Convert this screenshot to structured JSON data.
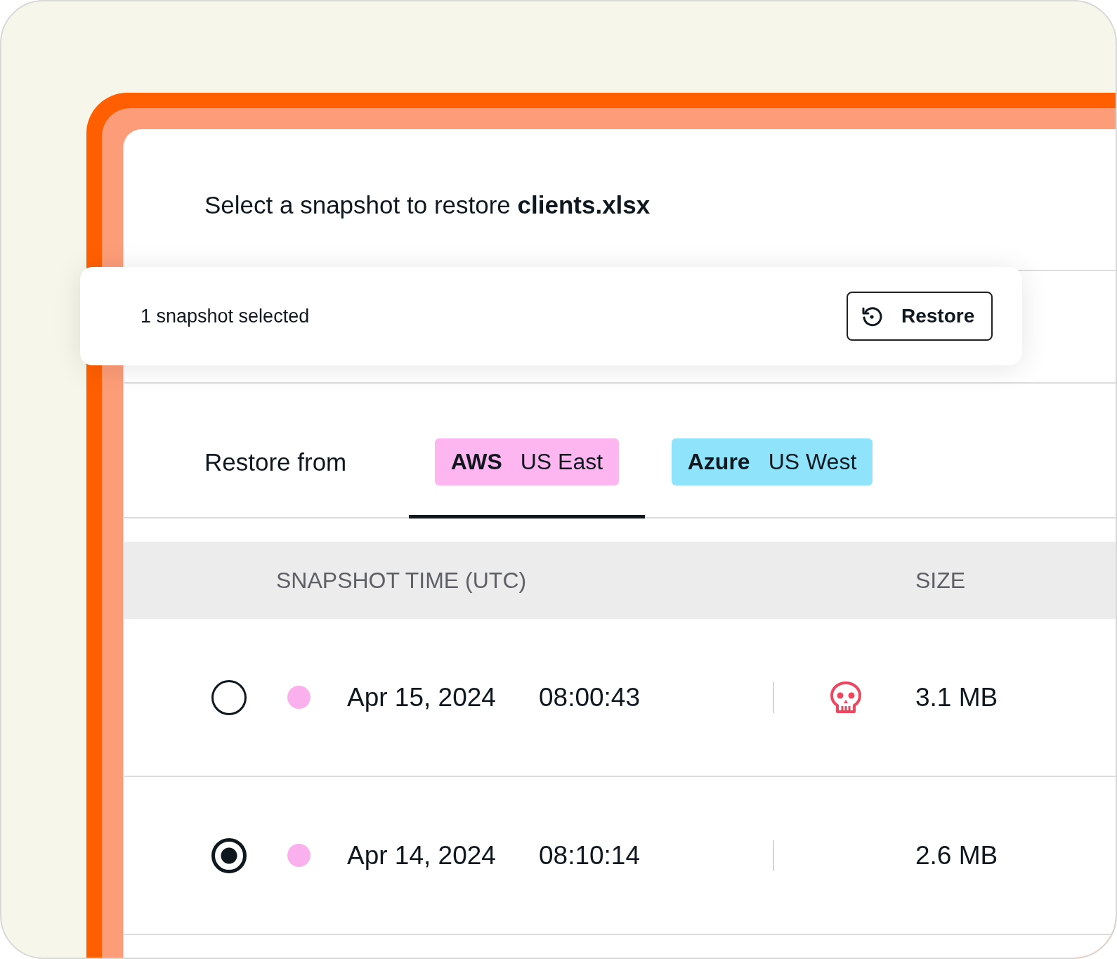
{
  "title": "Select a snapshot to restore **clients.xlsx**",
  "selection_bar": {
    "text": "1 snapshot selected",
    "button": "Restore"
  },
  "restore_from": {
    "label": "Restore from",
    "tabs": [
      {
        "provider": "AWS",
        "region": "US East",
        "color": "#fdb6f0",
        "selected": true
      },
      {
        "provider": "Azure",
        "region": "US West",
        "color": "#8fe3fb",
        "selected": false
      }
    ]
  },
  "table": {
    "columns": [
      "SNAPSHOT TIME (UTC)",
      "SIZE"
    ],
    "rows": [
      {
        "selected": false,
        "color": "#fbb0ee",
        "date": "Apr 15, 2024",
        "time": "08:00:43",
        "threat": true,
        "size": "3.1 MB"
      },
      {
        "selected": true,
        "color": "#fbb0ee",
        "date": "Apr 14, 2024",
        "time": "08:10:14",
        "threat": false,
        "size": "2.6 MB"
      }
    ]
  }
}
